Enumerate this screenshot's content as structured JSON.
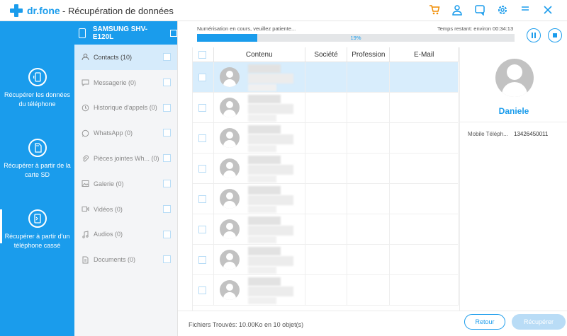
{
  "app": {
    "logo_text": "dr.fone",
    "title": "- Récupération de données",
    "icons": [
      "cart-icon",
      "user-icon",
      "feedback-icon",
      "settings-icon",
      "minimize-icon",
      "close-icon"
    ]
  },
  "leftnav": {
    "items": [
      {
        "label": "Récupérer les données du téléphone",
        "icon": "phone-recover-icon"
      },
      {
        "label": "Récupérer à partir de la carte SD",
        "icon": "sd-card-icon"
      },
      {
        "label": "Récupérer à partir d'un téléphone cassé",
        "icon": "broken-phone-icon",
        "active": true
      }
    ]
  },
  "device": {
    "name": "SAMSUNG SHV-E120L"
  },
  "categories": [
    {
      "label": "Contacts (10)",
      "icon": "contacts-icon",
      "active": true
    },
    {
      "label": "Messagerie (0)",
      "icon": "message-icon"
    },
    {
      "label": "Historique d'appels (0)",
      "icon": "call-log-icon"
    },
    {
      "label": "WhatsApp (0)",
      "icon": "whatsapp-icon"
    },
    {
      "label": "Pièces jointes Wh...  (0)",
      "icon": "attachment-icon"
    },
    {
      "label": "Galerie (0)",
      "icon": "gallery-icon"
    },
    {
      "label": "Vidéos (0)",
      "icon": "video-icon"
    },
    {
      "label": "Audios (0)",
      "icon": "audio-icon"
    },
    {
      "label": "Documents (0)",
      "icon": "document-icon"
    }
  ],
  "progress": {
    "status": "Numérisation en cours, veuillez patiente...",
    "time_remaining": "Temps restant: environ 00:34:13",
    "percent_label": "19%",
    "percent": 19
  },
  "table": {
    "headers": {
      "content": "Contenu",
      "company": "Société",
      "profession": "Profession",
      "email": "E-Mail"
    },
    "row_count": 8,
    "selected_row": 0
  },
  "detail": {
    "name": "Daniele",
    "field_label": "Mobile Téléph...",
    "field_value": "13426450011"
  },
  "footer": {
    "found": "Fichiers Trouvés: 10.00Ko en 10 objet(s)",
    "back_label": "Retour",
    "recover_label": "Récupérer"
  },
  "colors": {
    "accent": "#1a9cec",
    "selected": "#d8edfc",
    "disabled_button": "#b9dcf6"
  }
}
